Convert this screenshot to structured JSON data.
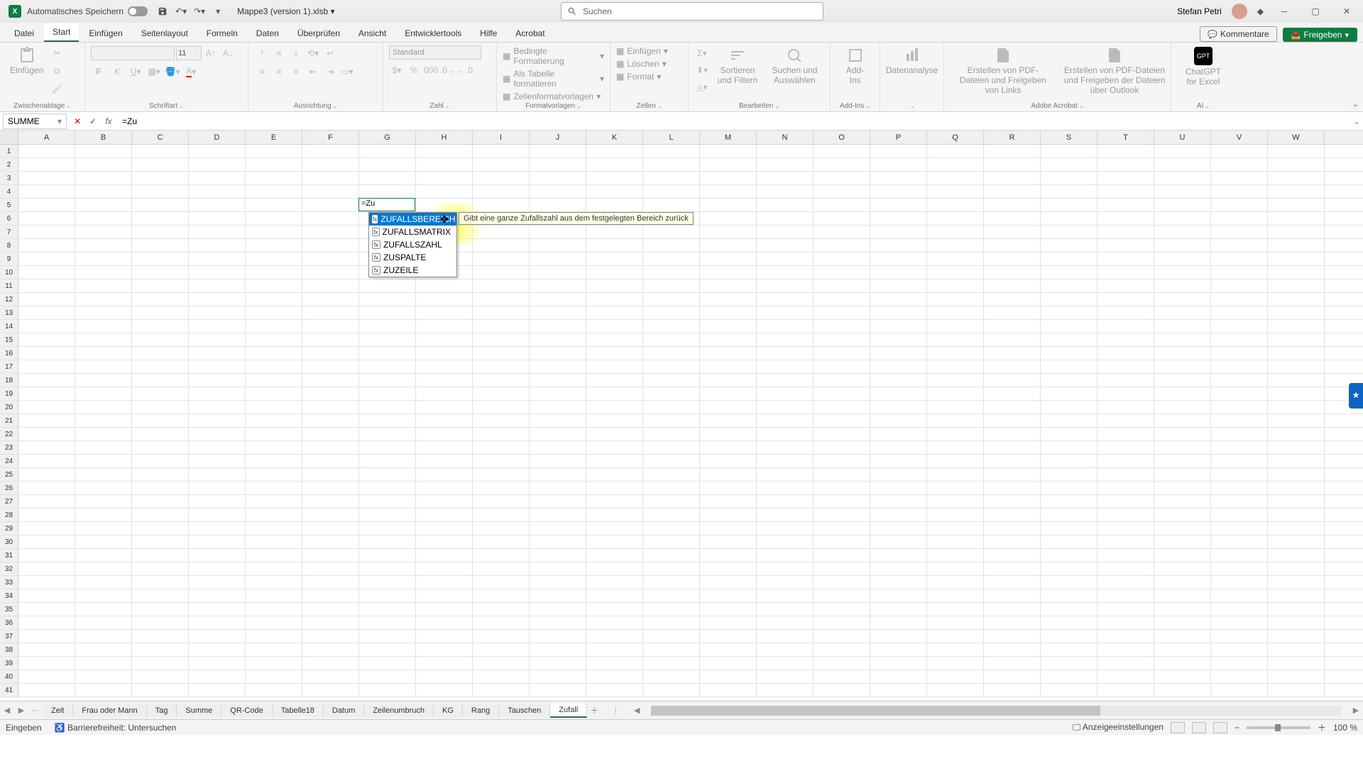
{
  "titlebar": {
    "autosave": "Automatisches Speichern",
    "filename": "Mappe3 (version 1).xlsb",
    "search_placeholder": "Suchen",
    "username": "Stefan Petri"
  },
  "tabs": {
    "items": [
      "Datei",
      "Start",
      "Einfügen",
      "Seitenlayout",
      "Formeln",
      "Daten",
      "Überprüfen",
      "Ansicht",
      "Entwicklertools",
      "Hilfe",
      "Acrobat"
    ],
    "active": "Start",
    "comments": "Kommentare",
    "share": "Freigeben"
  },
  "ribbon": {
    "paste": "Einfügen",
    "clipboard": "Zwischenablage",
    "font": "Schriftart",
    "alignment": "Ausrichtung",
    "number": "Zahl",
    "number_format": "Standard",
    "styles": "Formatvorlagen",
    "cond_format": "Bedingte Formatierung",
    "as_table": "Als Tabelle formatieren",
    "cell_styles": "Zellenformatvorlagen",
    "cells": "Zellen",
    "insert": "Einfügen",
    "delete": "Löschen",
    "format": "Format",
    "editing": "Bearbeiten",
    "sort": "Sortieren und Filtern",
    "find": "Suchen und Auswählen",
    "addins": "Add-Ins",
    "addins_btn": "Add-Ins",
    "analysis": "Datenanalyse",
    "acrobat": "Adobe Acrobat",
    "pdf_links": "Erstellen von PDF-Dateien und Freigeben von Links",
    "pdf_outlook": "Erstellen von PDF-Dateien und Freigeben der Dateien über Outlook",
    "ai": "AI",
    "gpt": "ChatGPT for Excel"
  },
  "formula": {
    "name": "SUMME",
    "text": "=Zu"
  },
  "columns": [
    "A",
    "B",
    "C",
    "D",
    "E",
    "F",
    "G",
    "H",
    "I",
    "J",
    "K",
    "L",
    "M",
    "N",
    "O",
    "P",
    "Q",
    "R",
    "S",
    "T",
    "U",
    "V",
    "W"
  ],
  "active_cell": {
    "value": "=Zu"
  },
  "autocomplete": {
    "items": [
      "ZUFALLSBEREICH",
      "ZUFALLSMATRIX",
      "ZUFALLSZAHL",
      "ZUSPALTE",
      "ZUZEILE"
    ],
    "tooltip": "Gibt eine ganze Zufallszahl aus dem festgelegten Bereich zurück"
  },
  "sheets": {
    "items": [
      "Zeit",
      "Frau oder Mann",
      "Tag",
      "Summe",
      "QR-Code",
      "Tabelle18",
      "Datum",
      "Zeilenumbruch",
      "KG",
      "Rang",
      "Tauschen",
      "Zufall"
    ],
    "active": "Zufall"
  },
  "status": {
    "mode": "Eingeben",
    "access": "Barrierefreiheit: Untersuchen",
    "display": "Anzeigeeinstellungen",
    "zoom": "100 %"
  }
}
